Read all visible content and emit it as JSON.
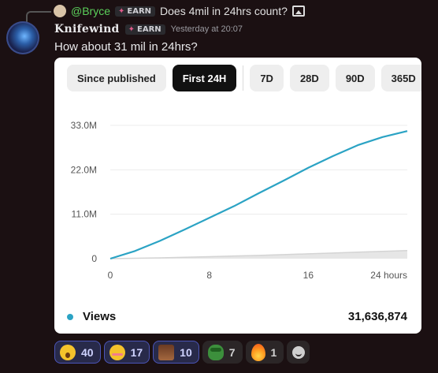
{
  "reply": {
    "mention": "@Bryce",
    "badge": "EARN",
    "text": "Does 4mil in 24hrs count?"
  },
  "message": {
    "username": "Knifewind",
    "badge": "EARN",
    "timestamp": "Yesterday at 20:07",
    "text": "How about 31 mil in 24hrs?"
  },
  "card": {
    "tabs": [
      {
        "label": "Since published",
        "active": false
      },
      {
        "label": "First 24H",
        "active": true
      },
      {
        "label": "7D",
        "active": false
      },
      {
        "label": "28D",
        "active": false
      },
      {
        "label": "90D",
        "active": false
      },
      {
        "label": "365D",
        "active": false
      }
    ],
    "legend": {
      "label": "Views",
      "value": "31,636,874"
    }
  },
  "chart_data": {
    "type": "line",
    "x": [
      0,
      2,
      4,
      6,
      8,
      10,
      12,
      14,
      16,
      18,
      20,
      22,
      24
    ],
    "series": [
      {
        "name": "Views",
        "values": [
          0,
          1.9,
          4.4,
          7.2,
          10.1,
          13.0,
          16.2,
          19.3,
          22.5,
          25.4,
          28.1,
          30.1,
          31.6
        ]
      },
      {
        "values": [
          0,
          0.1,
          0.2,
          0.35,
          0.5,
          0.65,
          0.8,
          1.0,
          1.2,
          1.4,
          1.6,
          1.8,
          2.0
        ]
      }
    ],
    "xticks": [
      "0",
      "8",
      "16",
      "24 hours"
    ],
    "xtick_values": [
      0,
      8,
      16,
      24
    ],
    "yticks": [
      "0",
      "11.0M",
      "22.0M",
      "33.0M"
    ],
    "ytick_values": [
      0,
      11,
      22,
      33
    ],
    "ylim": [
      0,
      33
    ],
    "xlim": [
      0,
      24
    ],
    "grid": true,
    "colors": {
      "main": "#2ba3c4",
      "baseline": "#d4d4d4"
    }
  },
  "reactions": [
    {
      "emoji": "astonished-face-emoji",
      "count": "40",
      "mine": true
    },
    {
      "emoji": "flushed-face-emoji",
      "count": "17",
      "mine": true
    },
    {
      "emoji": "custom-face-emoji",
      "count": "10",
      "mine": true
    },
    {
      "emoji": "pepe-frog-emoji",
      "count": "7",
      "mine": false
    },
    {
      "emoji": "fire-emoji",
      "count": "1",
      "mine": false
    }
  ]
}
